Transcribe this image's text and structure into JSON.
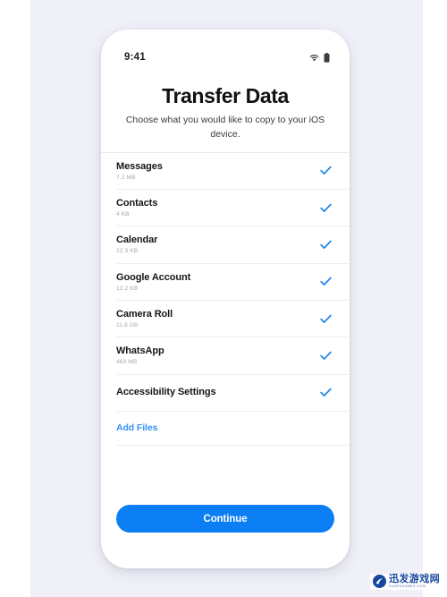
{
  "statusbar": {
    "time": "9:41",
    "wifi_icon": "wifi-icon",
    "battery_icon": "battery-icon"
  },
  "header": {
    "title": "Transfer Data",
    "subtitle": "Choose what you would like to copy to your iOS device."
  },
  "list": {
    "items": [
      {
        "label": "Messages",
        "size": "7.2 MB",
        "checked": true
      },
      {
        "label": "Contacts",
        "size": "4 KB",
        "checked": true
      },
      {
        "label": "Calendar",
        "size": "22.3 KB",
        "checked": true
      },
      {
        "label": "Google Account",
        "size": "12.2 KB",
        "checked": true
      },
      {
        "label": "Camera Roll",
        "size": "11.8 GB",
        "checked": true
      },
      {
        "label": "WhatsApp",
        "size": "463 MB",
        "checked": true
      },
      {
        "label": "Accessibility Settings",
        "size": "",
        "checked": true
      }
    ],
    "add_files_label": "Add Files"
  },
  "footer": {
    "continue_label": "Continue"
  },
  "watermark": {
    "title": "迅发游戏网",
    "subtitle": "XUNFAGAMES.COM"
  },
  "colors": {
    "accent": "#0b7ef4",
    "check": "#1a86e8",
    "link": "#3593f5",
    "backdrop": "#f0f0f8",
    "card": "#ffffff",
    "title_text": "#111114",
    "size_text": "#a8a8ae",
    "separator": "#eeeef2"
  }
}
